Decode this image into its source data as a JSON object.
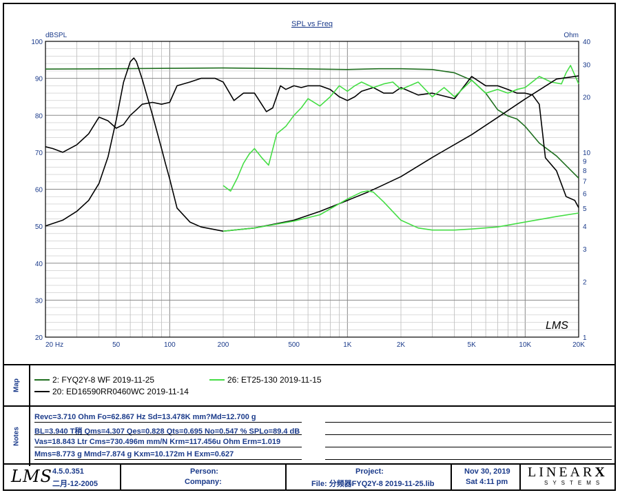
{
  "chart_data": {
    "type": "line",
    "title": "SPL vs Freq",
    "ylabel_left": "dBSPL",
    "ylabel_right": "Ohm",
    "x_scale": "log",
    "xlim": [
      20,
      20000
    ],
    "ylim_left": [
      20,
      100
    ],
    "ylim_right": [
      1,
      40
    ],
    "y_right_scale": "log",
    "grid": true,
    "x_tick_labels": [
      "20 Hz",
      "50",
      "100",
      "200",
      "500",
      "1K",
      "2K",
      "5K",
      "10K",
      "20K"
    ],
    "x_tick_values": [
      20,
      50,
      100,
      200,
      500,
      1000,
      2000,
      5000,
      10000,
      20000
    ],
    "y_left_ticks": [
      20,
      30,
      40,
      50,
      60,
      70,
      80,
      90,
      100
    ],
    "y_right_tick_labels": [
      "1",
      "2",
      "3",
      "4",
      "5",
      "6",
      "7",
      "8",
      "9",
      "10",
      "20",
      "30",
      "40"
    ],
    "y_right_tick_values": [
      1,
      2,
      3,
      4,
      5,
      6,
      7,
      8,
      9,
      10,
      20,
      30,
      40
    ],
    "series": [
      {
        "name": "2: FYQ2Y-8 WF 2019-11-25",
        "color": "#1e6e1e",
        "axis": "left",
        "x": [
          20,
          50,
          100,
          200,
          500,
          1000,
          1500,
          2000,
          3000,
          4000,
          5000,
          6000,
          7000,
          8000,
          9000,
          10000,
          12000,
          15000,
          20000
        ],
        "y": [
          92.5,
          92.6,
          92.7,
          92.8,
          92.6,
          92.4,
          92.6,
          92.6,
          92.4,
          91.5,
          89.5,
          86,
          81.5,
          79.8,
          79,
          77,
          72.5,
          69,
          63
        ]
      },
      {
        "name": "20: ED16590RR0460WC 2019-11-14",
        "color": "#000000",
        "axis": "left",
        "x": [
          20,
          22,
          25,
          30,
          35,
          40,
          45,
          50,
          55,
          60,
          65,
          70,
          80,
          90,
          100,
          110,
          130,
          150,
          180,
          200,
          230,
          260,
          300,
          350,
          380,
          420,
          450,
          500,
          550,
          600,
          700,
          800,
          900,
          1000,
          1100,
          1200,
          1400,
          1600,
          1800,
          2000,
          2500,
          3000,
          4000,
          5000,
          6000,
          7000,
          8000,
          9000,
          10000,
          11000,
          12000,
          13000,
          15000,
          17000,
          19000,
          20000
        ],
        "y": [
          71.5,
          71,
          70,
          72,
          75,
          79.5,
          78.5,
          76.5,
          77.5,
          80,
          81.5,
          83,
          83.5,
          83,
          83.5,
          88,
          89,
          90,
          90,
          89,
          84,
          86,
          86,
          81,
          82,
          88,
          87,
          88,
          87.5,
          88,
          88,
          87,
          85,
          84,
          85,
          86.5,
          87.5,
          86,
          86,
          87.5,
          85.5,
          86,
          84.5,
          90.5,
          88,
          88,
          87,
          86,
          86,
          85.5,
          83,
          68.5,
          65,
          58,
          57,
          55
        ]
      },
      {
        "name": "26: ET25-130 2019-11-15",
        "color": "#44dd44",
        "axis": "left",
        "x": [
          200,
          220,
          240,
          260,
          280,
          300,
          330,
          360,
          400,
          450,
          500,
          550,
          600,
          700,
          800,
          900,
          1000,
          1100,
          1200,
          1400,
          1600,
          1800,
          2000,
          2500,
          3000,
          3500,
          4000,
          5000,
          6000,
          7000,
          8000,
          9000,
          10000,
          12000,
          14000,
          16000,
          17000,
          18000,
          20000
        ],
        "y": [
          61,
          59.5,
          63,
          67,
          69.5,
          71,
          68.5,
          66.5,
          75,
          77,
          80,
          82,
          84.5,
          82.5,
          85,
          88,
          86.5,
          88,
          89,
          87.5,
          88.5,
          89,
          87,
          89,
          85,
          87.5,
          85,
          89.5,
          86,
          87,
          86,
          87,
          87.5,
          90.5,
          89,
          88.5,
          91.5,
          93.5,
          88.5
        ]
      },
      {
        "name": "20: ED16590RR0460WC 2019-11-14 (impedance)",
        "color": "#000000",
        "axis": "right",
        "x": [
          20,
          25,
          30,
          35,
          40,
          45,
          50,
          55,
          60,
          62.867,
          65,
          70,
          80,
          90,
          95,
          100,
          110,
          130,
          150,
          200,
          300,
          500,
          700,
          1000,
          1300,
          1500,
          2000,
          3000,
          5000,
          7000,
          10000,
          15000,
          20000
        ],
        "y": [
          4,
          4.3,
          4.8,
          5.5,
          6.8,
          9.5,
          15,
          24,
          31,
          32.5,
          31,
          25,
          16,
          10.5,
          8.6,
          7.2,
          5,
          4.2,
          3.95,
          3.75,
          3.9,
          4.3,
          4.8,
          5.5,
          6.1,
          6.5,
          7.4,
          9.4,
          12.5,
          15.5,
          19.5,
          25,
          26
        ]
      },
      {
        "name": "26: ET25-130 2019-11-15 (impedance)",
        "color": "#44dd44",
        "axis": "right",
        "x": [
          200,
          300,
          500,
          700,
          1000,
          1200,
          1300,
          1400,
          1600,
          2000,
          2500,
          3000,
          4000,
          5000,
          7000,
          10000,
          15000,
          20000
        ],
        "y": [
          3.75,
          3.9,
          4.25,
          4.6,
          5.6,
          6.1,
          6.2,
          6.1,
          5.4,
          4.3,
          3.9,
          3.8,
          3.8,
          3.85,
          3.95,
          4.2,
          4.5,
          4.7
        ]
      }
    ],
    "watermark": "LMS"
  },
  "map": {
    "sidebar_label": "Map",
    "legend": [
      {
        "label": "2: FYQ2Y-8 WF 2019-11-25",
        "color": "#1e6e1e"
      },
      {
        "label": "20: ED16590RR0460WC 2019-11-14",
        "color": "#000000"
      },
      {
        "label": "26: ET25-130 2019-11-15",
        "color": "#44dd44"
      }
    ]
  },
  "notes": {
    "sidebar_label": "Notes",
    "rows": [
      "Revc=3.710 Ohm  Fo=62.867 Hz  Sd=13.478K mm?Md=12.700 g",
      "BL=3.940 T稍  Qms=4.307  Qes=0.828  Qts=0.695  No=0.547 %  SPLo=89.4 dB",
      "Vas=18.843 Ltr  Cms=730.496m mm/N  Krm=117.456u Ohm  Erm=1.019",
      "Mms=8.773 g  Mmd=7.874 g  Kxm=10.172m H  Exm=0.627"
    ]
  },
  "footer": {
    "logo": "LMS",
    "version": "4.5.0.351",
    "build_date": "二月-12-2005",
    "person_label": "Person:",
    "company_label": "Company:",
    "project_label": "Project:",
    "file_label": "File: 分频器FYQ2Y-8 2019-11-25.lib",
    "date": "Nov 30, 2019",
    "time": "Sat  4:11 pm",
    "brand": "LINEAR",
    "brand_x": "X",
    "brand_sub": "SYSTEMS"
  }
}
